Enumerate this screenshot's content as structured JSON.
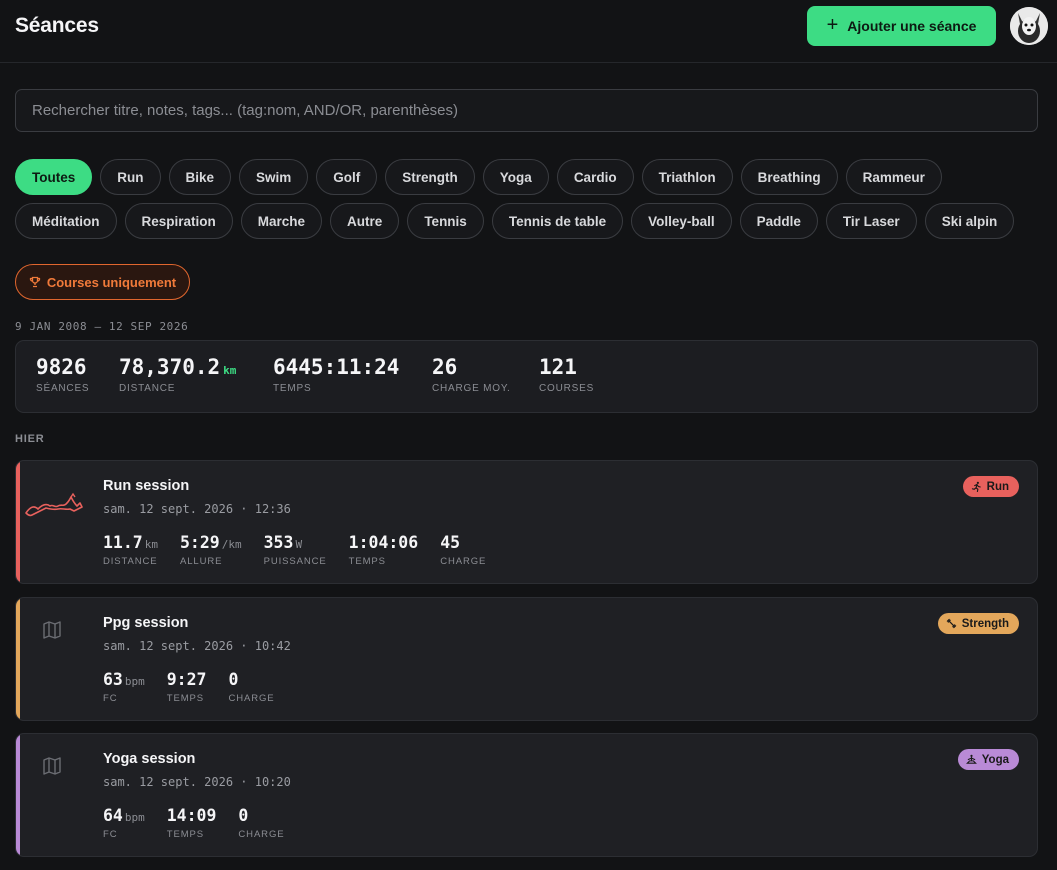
{
  "header": {
    "title": "Séances",
    "add_button": "Ajouter une séance"
  },
  "search": {
    "placeholder": "Rechercher titre, notes, tags... (tag:nom, AND/OR, parenthèses)",
    "value": ""
  },
  "filters": [
    "Toutes",
    "Run",
    "Bike",
    "Swim",
    "Golf",
    "Strength",
    "Yoga",
    "Cardio",
    "Triathlon",
    "Breathing",
    "Rammeur",
    "Méditation",
    "Respiration",
    "Marche",
    "Autre",
    "Tennis",
    "Tennis de table",
    "Volley-ball",
    "Paddle",
    "Tir Laser",
    "Ski alpin"
  ],
  "active_filter": "Toutes",
  "races_button": "Courses uniquement",
  "date_range": "9 JAN 2008 – 12 SEP 2026",
  "stats": {
    "sessions": {
      "value": "9826",
      "label": "SÉANCES"
    },
    "distance": {
      "value": "78,370.2",
      "unit": "km",
      "label": "DISTANCE"
    },
    "time": {
      "value": "6445:11:24",
      "label": "TEMPS"
    },
    "load": {
      "value": "26",
      "label": "CHARGE MOY."
    },
    "races": {
      "value": "121",
      "label": "COURSES"
    }
  },
  "day_label": "HIER",
  "sessions": [
    {
      "title": "Run session",
      "datetime": "sam. 12 sept. 2026 · 12:36",
      "badge": "Run",
      "color": "#e8615d",
      "metrics": [
        {
          "value": "11.7",
          "unit": "km",
          "label": "DISTANCE"
        },
        {
          "value": "5:29",
          "unit": "/km",
          "label": "ALLURE"
        },
        {
          "value": "353",
          "unit": "W",
          "label": "PUISSANCE"
        },
        {
          "value": "1:04:06",
          "unit": "",
          "label": "TEMPS"
        },
        {
          "value": "45",
          "unit": "",
          "label": "CHARGE"
        }
      ]
    },
    {
      "title": "Ppg session",
      "datetime": "sam. 12 sept. 2026 · 10:42",
      "badge": "Strength",
      "color": "#e3a75b",
      "metrics": [
        {
          "value": "63",
          "unit": "bpm",
          "label": "FC"
        },
        {
          "value": "9:27",
          "unit": "",
          "label": "TEMPS"
        },
        {
          "value": "0",
          "unit": "",
          "label": "CHARGE"
        }
      ]
    },
    {
      "title": "Yoga session",
      "datetime": "sam. 12 sept. 2026 · 10:20",
      "badge": "Yoga",
      "color": "#b98ad6",
      "metrics": [
        {
          "value": "64",
          "unit": "bpm",
          "label": "FC"
        },
        {
          "value": "14:09",
          "unit": "",
          "label": "TEMPS"
        },
        {
          "value": "0",
          "unit": "",
          "label": "CHARGE"
        }
      ]
    }
  ]
}
